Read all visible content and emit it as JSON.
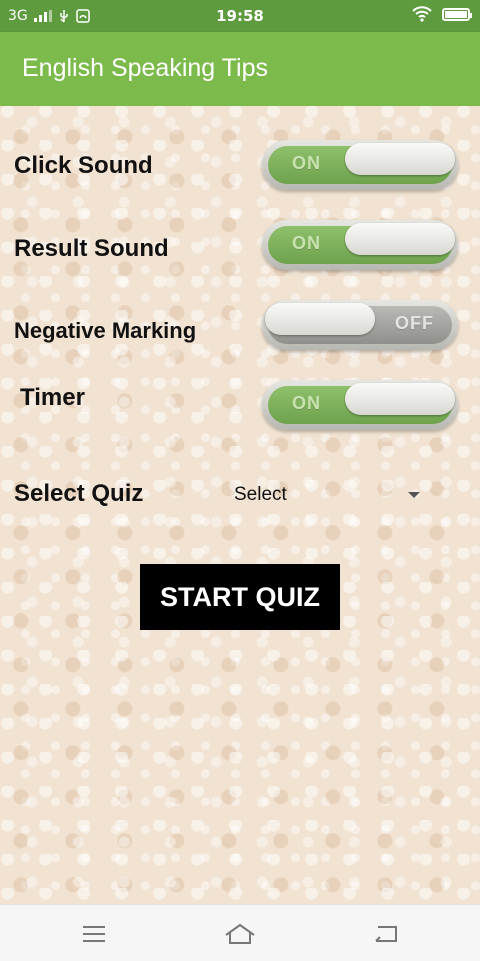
{
  "status_bar": {
    "network": "3G",
    "time": "19:58",
    "battery_level": 1.0
  },
  "app_bar": {
    "title": "English Speaking Tips"
  },
  "settings": [
    {
      "label": "Click Sound",
      "state": "ON"
    },
    {
      "label": "Result Sound",
      "state": "ON"
    },
    {
      "label": "Negative Marking",
      "state": "OFF"
    },
    {
      "label": "Timer",
      "state": "ON"
    }
  ],
  "quiz_select": {
    "label": "Select Quiz",
    "value": "Select"
  },
  "start_button": {
    "label": "START QUIZ"
  },
  "colors": {
    "status_bar": "#5e9a3e",
    "app_bar": "#7cba4c",
    "toggle_on": "#7cb25a",
    "toggle_off": "#a5a5a1",
    "button": "#000000"
  },
  "icons": [
    "signal-icon",
    "usb-icon",
    "notification-icon",
    "wifi-icon",
    "battery-icon",
    "menu-icon",
    "home-icon",
    "back-icon"
  ]
}
